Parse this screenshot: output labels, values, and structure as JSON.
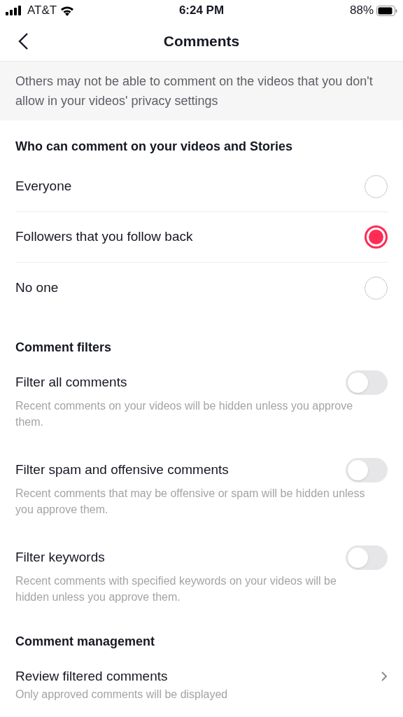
{
  "status_bar": {
    "carrier": "AT&T",
    "time": "6:24 PM",
    "battery": "88%"
  },
  "header": {
    "title": "Comments"
  },
  "notice": "Others may not be able to comment on the videos that you don't allow in your videos' privacy settings",
  "audience": {
    "title": "Who can comment on your videos and Stories",
    "options": [
      {
        "label": "Everyone",
        "selected": false
      },
      {
        "label": "Followers that you follow back",
        "selected": true
      },
      {
        "label": "No one",
        "selected": false
      }
    ]
  },
  "filters": {
    "title": "Comment filters",
    "items": [
      {
        "label": "Filter all comments",
        "on": false,
        "description": "Recent comments on your videos will be hidden unless you approve them."
      },
      {
        "label": "Filter spam and offensive comments",
        "on": false,
        "description": "Recent comments that may be offensive or spam will be hidden unless you approve them."
      },
      {
        "label": "Filter keywords",
        "on": false,
        "description": "Recent comments with specified keywords on your videos will be hidden unless you approve them."
      }
    ]
  },
  "management": {
    "title": "Comment management",
    "items": [
      {
        "label": "Review filtered comments",
        "description": "Only approved comments will be displayed"
      }
    ]
  }
}
